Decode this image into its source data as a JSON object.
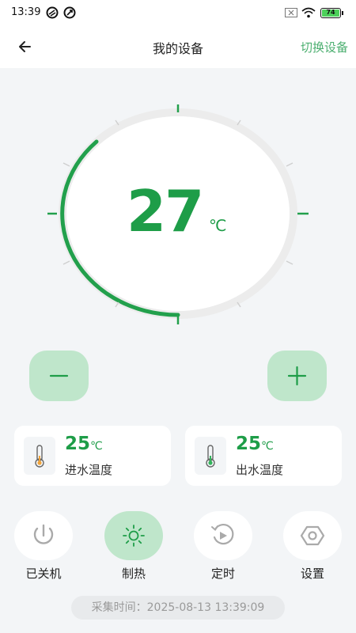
{
  "status_bar": {
    "time": "13:39",
    "battery": "74",
    "icons": [
      "notification-icon",
      "notification-icon",
      "close-box-icon",
      "wifi-icon",
      "battery-icon"
    ]
  },
  "header": {
    "back_icon": "arrow-left-icon",
    "title": "我的设备",
    "switch_label": "切换设备"
  },
  "thermostat": {
    "value": "27",
    "unit": "℃",
    "accent": "#1e9d48"
  },
  "controls": {
    "minus_label": "−",
    "plus_label": "+"
  },
  "cards": [
    {
      "value": "25",
      "unit": "℃",
      "label": "进水温度",
      "icon": "thermometer-icon"
    },
    {
      "value": "25",
      "unit": "℃",
      "label": "出水温度",
      "icon": "thermometer-icon"
    }
  ],
  "actions": [
    {
      "label": "已关机",
      "icon": "power-icon",
      "active": false
    },
    {
      "label": "制热",
      "icon": "sun-icon",
      "active": true
    },
    {
      "label": "定时",
      "icon": "timer-icon",
      "active": false
    },
    {
      "label": "设置",
      "icon": "settings-icon",
      "active": false
    }
  ],
  "collect_time": "采集时间：2025-08-13 13:39:09"
}
